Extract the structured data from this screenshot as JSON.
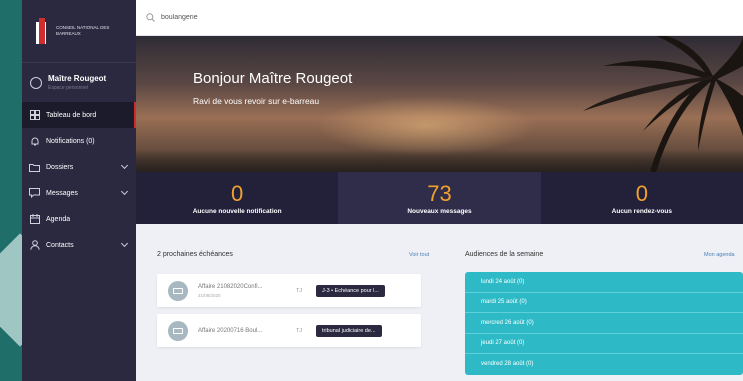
{
  "brand": {
    "org_name": "Conseil National des Barreaux"
  },
  "profile": {
    "name": "Maître Rougeot",
    "subtitle": "Espace personnel"
  },
  "sidebar": {
    "items": [
      {
        "label": "Tableau de bord",
        "icon": "dashboard-icon",
        "active": true
      },
      {
        "label": "Notifications (0)",
        "icon": "bell-icon"
      },
      {
        "label": "Dossiers",
        "icon": "folder-icon",
        "expandable": true
      },
      {
        "label": "Messages",
        "icon": "chat-icon",
        "expandable": true
      },
      {
        "label": "Agenda",
        "icon": "calendar-icon"
      },
      {
        "label": "Contacts",
        "icon": "user-icon",
        "expandable": true
      }
    ]
  },
  "search": {
    "value": "boulangerie"
  },
  "hero": {
    "greeting": "Bonjour Maître Rougeot",
    "subtitle": "Ravi de vous revoir sur e-barreau"
  },
  "stats": [
    {
      "value": "0",
      "label": "Aucune nouvelle notification"
    },
    {
      "value": "73",
      "label": "Nouveaux messages"
    },
    {
      "value": "0",
      "label": "Aucun rendez-vous"
    }
  ],
  "deadlines": {
    "title": "2 prochaines échéances",
    "link": "Voir tout",
    "items": [
      {
        "title": "Affaire 21082020Confi...",
        "date": "21/08/2020",
        "tag": "TJ",
        "badge": "J-3 • Echéance pour l..."
      },
      {
        "title": "Affaire 20200716 Boul...",
        "date": "",
        "tag": "TJ",
        "badge": "tribunal judiciaire de..."
      }
    ]
  },
  "hearings": {
    "title": "Audiences de la semaine",
    "link": "Mon agenda",
    "days": [
      "lundi 24 août (0)",
      "mardi 25 août (0)",
      "mercred 26 août (0)",
      "jeudi 27 août (0)",
      "vendred 28 août (0)"
    ]
  },
  "colors": {
    "sidebar": "#2b2940",
    "accent": "#d12d2d",
    "stat_number": "#f0a12e",
    "hearings": "#2dbac6"
  }
}
